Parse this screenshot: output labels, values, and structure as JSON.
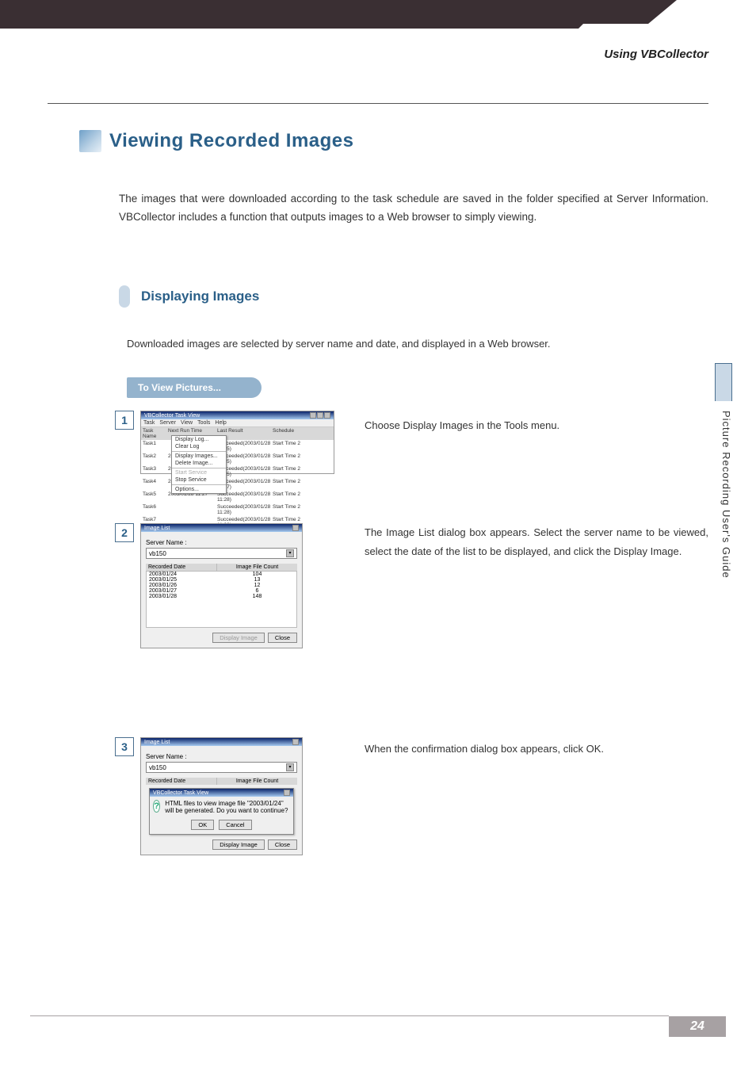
{
  "header": {
    "chapter": "Using VBCollector"
  },
  "section": {
    "title": "Viewing Recorded Images",
    "intro": "The images that were downloaded according to the task schedule are saved in the folder specified at Server Information. VBCollector includes a function that outputs images to a Web browser to simply viewing."
  },
  "subsection": {
    "title": "Displaying Images",
    "intro": "Downloaded images are selected by server name and date, and displayed in a Web browser.",
    "callout": "To View Pictures..."
  },
  "steps": {
    "s1": {
      "num": "1",
      "text": "Choose Display Images in the Tools menu."
    },
    "s2": {
      "num": "2",
      "text": "The Image List dialog box appears. Select the server name to be viewed, select the date of the list to be displayed, and click the Display Image."
    },
    "s3": {
      "num": "3",
      "text": "When the confirmation dialog box appears, click OK."
    }
  },
  "mock1": {
    "title": "VBCollector Task View",
    "menubar": [
      "Task",
      "Server",
      "View",
      "Tools",
      "Help"
    ],
    "dropdown": [
      "Display Log...",
      "Clear Log",
      "Display Images...",
      "Delete Image...",
      "Start Service",
      "Stop Service",
      "Options..."
    ],
    "columns": [
      "Task Name",
      "Next Run Time",
      "Last Result",
      "Schedule"
    ],
    "rows": [
      [
        "Task1",
        "",
        "Succeeded(2003/01/28 11:25)",
        "Start Time 2"
      ],
      [
        "Task2",
        "2003/01/28 11:25",
        "Succeeded(2003/01/28 11:25)",
        "Start Time 2"
      ],
      [
        "Task3",
        "2003/01/28 11:25",
        "Succeeded(2003/01/28 11:25)",
        "Start Time 2"
      ],
      [
        "Task4",
        "2003/01/28 11:25",
        "Succeeded(2003/01/28 11:27)",
        "Start Time 2"
      ],
      [
        "Task5",
        "2003/01/28 11:27",
        "Succeeded(2003/01/28 11:28)",
        "Start Time 2"
      ],
      [
        "Task6",
        "",
        "Succeeded(2003/01/28 11:28)",
        "Start Time 2"
      ],
      [
        "Task7",
        "",
        "Succeeded(2003/01/28 11:29)",
        "Start Time 2"
      ]
    ]
  },
  "mock2": {
    "title": "Image List",
    "server_label": "Server Name :",
    "server_value": "vb150",
    "listhead": [
      "Recorded Date",
      "Image File Count"
    ],
    "rows": [
      [
        "2003/01/24",
        "104"
      ],
      [
        "2003/01/25",
        "13"
      ],
      [
        "2003/01/26",
        "12"
      ],
      [
        "2003/01/27",
        "6"
      ],
      [
        "2003/01/28",
        "148"
      ]
    ],
    "btn_display": "Display Image",
    "btn_close": "Close"
  },
  "mock3": {
    "title": "Image List",
    "server_label": "Server Name :",
    "server_value": "vb150",
    "listhead": [
      "Recorded Date",
      "Image File Count"
    ],
    "confirm_title": "VBCollector Task View",
    "confirm_msg": "HTML files to view image file \"2003/01/24\" will be generated. Do you want to continue?",
    "btn_ok": "OK",
    "btn_cancel": "Cancel",
    "btn_display": "Display Image",
    "btn_close": "Close"
  },
  "side_tab": "Picture Recording User's Guide",
  "page_num": "24"
}
